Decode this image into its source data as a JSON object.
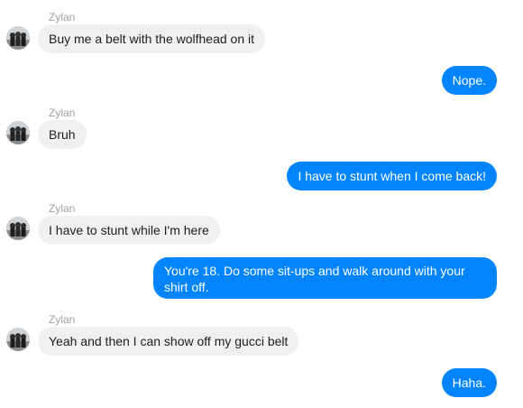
{
  "conversation": {
    "messages": [
      {
        "direction": "incoming",
        "sender": "Zylan",
        "text": "Buy me a belt with the wolfhead on it"
      },
      {
        "direction": "outgoing",
        "text": "Nope."
      },
      {
        "direction": "incoming",
        "sender": "Zylan",
        "text": "Bruh"
      },
      {
        "direction": "outgoing",
        "text": "I have to stunt when I come back!"
      },
      {
        "direction": "incoming",
        "sender": "Zylan",
        "text": "I have to stunt while I'm here"
      },
      {
        "direction": "outgoing",
        "text": "You're 18. Do some sit-ups and walk around with your shirt off."
      },
      {
        "direction": "incoming",
        "sender": "Zylan",
        "text": "Yeah and then I can show off my gucci belt"
      },
      {
        "direction": "outgoing",
        "text": "Haha."
      }
    ]
  },
  "colors": {
    "incoming_bubble": "#f0f0f0",
    "outgoing_bubble": "#0084ff",
    "sender_name": "#a0a0a0"
  }
}
